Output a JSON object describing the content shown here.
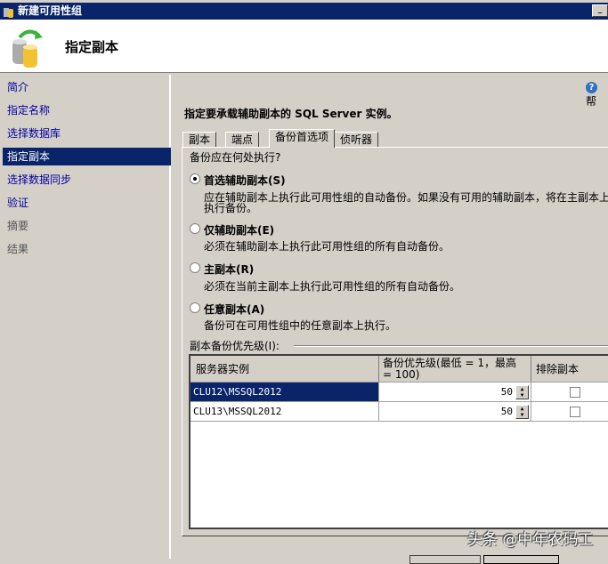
{
  "window": {
    "title": "新建可用性组",
    "minimize": "_"
  },
  "header": {
    "title": "指定副本"
  },
  "sidebar": {
    "items": [
      {
        "label": "简介",
        "state": "link"
      },
      {
        "label": "指定名称",
        "state": "link"
      },
      {
        "label": "选择数据库",
        "state": "link"
      },
      {
        "label": "指定副本",
        "state": "selected"
      },
      {
        "label": "选择数据同步",
        "state": "link"
      },
      {
        "label": "验证",
        "state": "link"
      },
      {
        "label": "摘要",
        "state": "disabled"
      },
      {
        "label": "结果",
        "state": "disabled"
      }
    ]
  },
  "help": {
    "label": "帮",
    "icon": "?"
  },
  "main": {
    "heading": "指定要承载辅助副本的 SQL Server 实例。",
    "tabs": [
      "副本",
      "端点",
      "备份首选项",
      "侦听器"
    ],
    "active_tab": "备份首选项",
    "question": "备份应在何处执行?",
    "options": [
      {
        "label": "首选辅助副本(S)",
        "desc": "应在辅助副本上执行此可用性组的自动备份。如果没有可用的辅助副本，将在主副本上",
        "desc2": "执行备份。",
        "selected": true
      },
      {
        "label": "仅辅助副本(E)",
        "desc": "必须在辅助副本上执行此可用性组的所有自动备份。",
        "selected": false
      },
      {
        "label": "主副本(R)",
        "desc": "必须在当前主副本上执行此可用性组的所有自动备份。",
        "selected": false
      },
      {
        "label": "任意副本(A)",
        "desc": "备份可在可用性组中的任意副本上执行。",
        "selected": false
      }
    ],
    "priority_label": "副本备份优先级(I):",
    "grid": {
      "columns": [
        "服务器实例",
        "备份优先级(最低 = 1，最高 = 100)",
        "排除副本"
      ],
      "rows": [
        {
          "instance": "CLU12\\MSSQL2012",
          "priority": "50",
          "exclude": false
        },
        {
          "instance": "CLU13\\MSSQL2012",
          "priority": "50",
          "exclude": false
        }
      ]
    }
  },
  "watermark": "头条 @中年农码工"
}
